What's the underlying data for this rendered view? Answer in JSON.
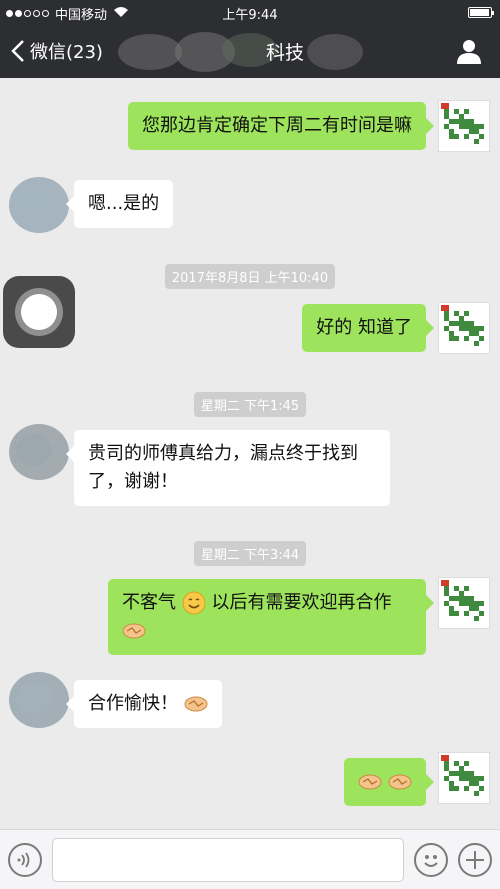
{
  "status": {
    "carrier": "中国移动",
    "time": "上午9:44",
    "battery_level": 0.95
  },
  "nav": {
    "back_label": "微信(23)",
    "title": "科技"
  },
  "messages": [
    {
      "side": "me",
      "text": "您那边肯定确定下周二有时间是嘛"
    },
    {
      "side": "them",
      "text": "嗯...是的"
    },
    {
      "type": "time",
      "text": "2017年8月8日 上午10:40"
    },
    {
      "side": "me",
      "text": "好的 知道了"
    },
    {
      "type": "time",
      "text": "星期二 下午1:45"
    },
    {
      "side": "them",
      "text_line1": "贵司的师傅真给力，漏点终于找到",
      "text_line2": "了，谢谢！"
    },
    {
      "type": "time",
      "text": "星期二 下午3:44"
    },
    {
      "side": "me",
      "text_a": "不客气",
      "text_b": "以后有需要欢迎再合作",
      "emojis": [
        "smile-emoji",
        "handshake-emoji"
      ]
    },
    {
      "side": "them",
      "text": "合作愉快！",
      "emojis": [
        "handshake-emoji"
      ]
    },
    {
      "side": "me",
      "emojis": [
        "handshake-emoji",
        "handshake-emoji"
      ]
    }
  ],
  "input": {
    "placeholder": ""
  },
  "icons": {
    "voice": "voice-icon",
    "emoji": "emoji-face-icon",
    "plus": "plus-icon",
    "profile": "person-icon"
  }
}
